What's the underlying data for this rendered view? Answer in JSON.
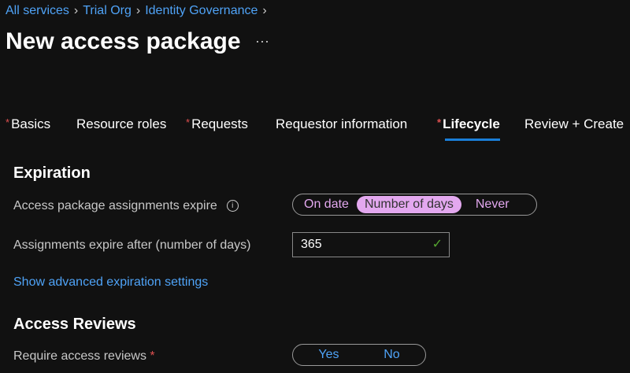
{
  "breadcrumb": [
    "All services",
    "Trial Org",
    "Identity Governance"
  ],
  "title": "New access package",
  "more": "···",
  "tabs": [
    {
      "label": "Basics",
      "required": true
    },
    {
      "label": "Resource roles",
      "required": false
    },
    {
      "label": "Requests",
      "required": true
    },
    {
      "label": "Requestor information",
      "required": false
    },
    {
      "label": "Lifecycle",
      "required": true,
      "active": true
    },
    {
      "label": "Review + Create",
      "required": false
    }
  ],
  "expiration": {
    "heading": "Expiration",
    "expire_label": "Access package assignments expire",
    "options": [
      "On date",
      "Number of days",
      "Never"
    ],
    "selected": "Number of days",
    "days_label": "Assignments expire after (number of days)",
    "days_value": "365",
    "advanced_link": "Show advanced expiration settings"
  },
  "reviews": {
    "heading": "Access Reviews",
    "require_label": "Require access reviews",
    "options": [
      "Yes",
      "No"
    ]
  },
  "req_mark": "*",
  "colors": {
    "accent": "#1a7fd8",
    "toggle": "#e3a8ef",
    "link": "#4fa3f7"
  }
}
